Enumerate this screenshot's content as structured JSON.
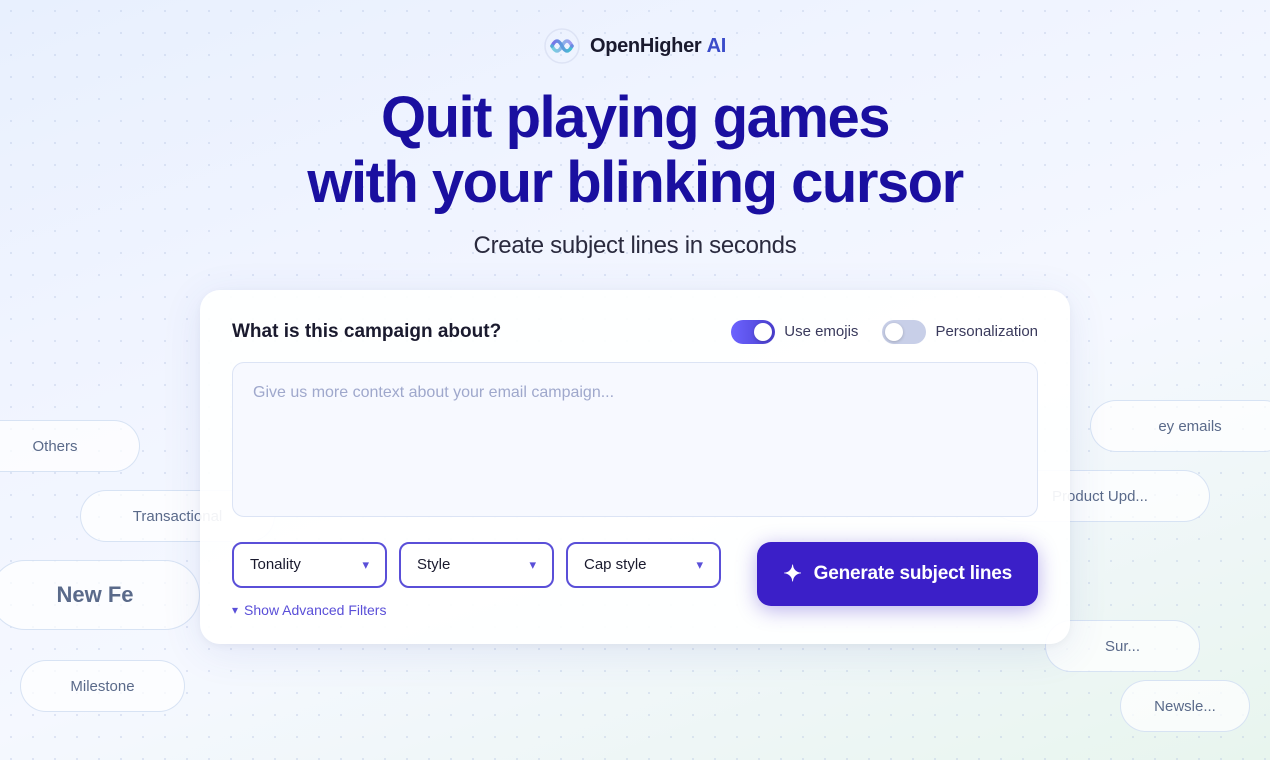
{
  "logo": {
    "icon_alt": "OpenHigher AI logo",
    "text_open": "Open",
    "text_higher": "Higher",
    "text_ai": "AI"
  },
  "hero": {
    "title_line1": "Quit playing games",
    "title_line2": "with your blinking cursor",
    "subtitle": "Create subject lines in seconds"
  },
  "card": {
    "question": "What is this campaign about?",
    "textarea_placeholder": "Give us more context about your email campaign...",
    "toggle_emojis_label": "Use emojis",
    "toggle_emojis_state": "on",
    "toggle_personalization_label": "Personalization",
    "toggle_personalization_state": "off",
    "dropdown_tonality": "Tonality",
    "dropdown_style": "Style",
    "dropdown_cap_style": "Cap style",
    "show_advanced_filters": "Show Advanced Filters",
    "generate_btn_label": "Generate subject lines"
  },
  "bg_pills": [
    {
      "id": "pill1",
      "text": "Others",
      "class": "pill-1"
    },
    {
      "id": "pill2",
      "text": "Transactional",
      "class": "pill-2"
    },
    {
      "id": "pill3",
      "text": "New Fe",
      "class": "pill-3"
    },
    {
      "id": "pill4",
      "text": "Milestone",
      "class": "pill-4"
    },
    {
      "id": "pill6",
      "text": "ey emails",
      "class": "pill-6"
    },
    {
      "id": "pill7",
      "text": "Product Upd...",
      "class": "pill-7"
    },
    {
      "id": "pill9",
      "text": "Sur...",
      "class": "pill-9"
    },
    {
      "id": "pill10",
      "text": "Newsle...",
      "class": "pill-10"
    }
  ]
}
